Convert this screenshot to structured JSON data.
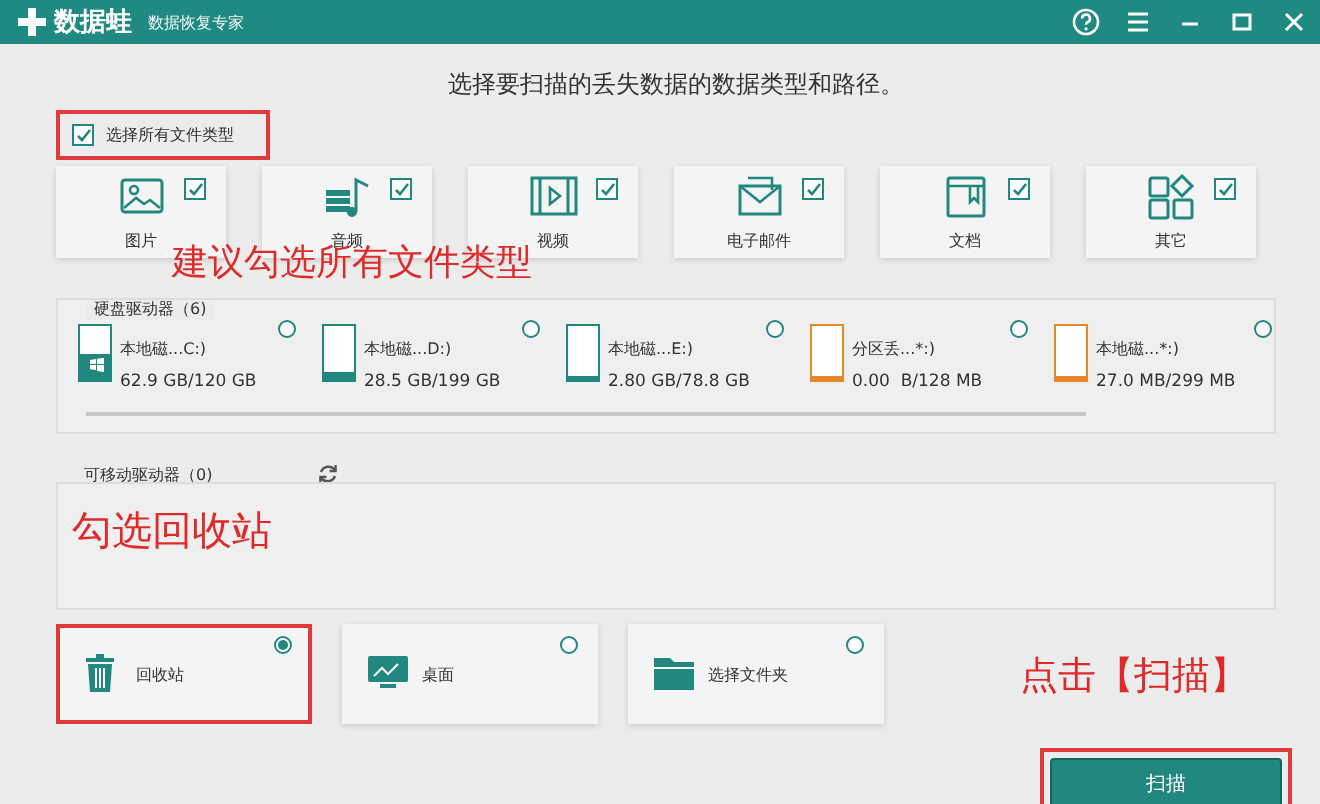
{
  "window": {
    "app_name": "数据蛙",
    "subtitle": "数据恢复专家"
  },
  "heading": "选择要扫描的丢失数据的数据类型和路径。",
  "select_all": {
    "label": "选择所有文件类型",
    "checked": true,
    "highlighted": true
  },
  "file_types": [
    {
      "kind": "image",
      "label": "图片",
      "checked": true
    },
    {
      "kind": "audio",
      "label": "音频",
      "checked": true
    },
    {
      "kind": "video",
      "label": "视频",
      "checked": true
    },
    {
      "kind": "email",
      "label": "电子邮件",
      "checked": true
    },
    {
      "kind": "document",
      "label": "文档",
      "checked": true
    },
    {
      "kind": "other",
      "label": "其它",
      "checked": true
    }
  ],
  "hard_drives": {
    "label": "硬盘驱动器（6)",
    "drives": [
      {
        "kind": "system",
        "name": "本地磁...C:)",
        "size": "62.9 GB/120 GB",
        "level": 0.5,
        "color": "#22877f",
        "selected": false
      },
      {
        "kind": "disk",
        "name": "本地磁...D:)",
        "size": "28.5 GB/199 GB",
        "level": 0.14,
        "color": "#22877f",
        "selected": false
      },
      {
        "kind": "disk",
        "name": "本地磁...E:)",
        "size": "2.80 GB/78.8 GB",
        "level": 0.04,
        "color": "#22877f",
        "selected": false
      },
      {
        "kind": "disk",
        "name": "分区丢...*:)",
        "size": "0.00  B/128 MB",
        "level": 0,
        "color": "#e8862a",
        "selected": false
      },
      {
        "kind": "disk",
        "name": "本地磁...*:)",
        "size": "27.0 MB/299 MB",
        "level": 0.09,
        "color": "#e8862a",
        "selected": false
      }
    ]
  },
  "removable": {
    "label": "可移动驱动器（0)"
  },
  "locations": [
    {
      "kind": "recycle",
      "label": "回收站",
      "selected": true,
      "highlighted": true
    },
    {
      "kind": "desktop",
      "label": "桌面",
      "selected": false,
      "highlighted": false
    },
    {
      "kind": "folder",
      "label": "选择文件夹",
      "selected": false,
      "highlighted": false
    }
  ],
  "scan_button": {
    "label": "扫描",
    "highlighted": true
  },
  "annotations": [
    "建议勾选所有文件类型",
    "勾选回收站",
    "点击【扫描】"
  ]
}
